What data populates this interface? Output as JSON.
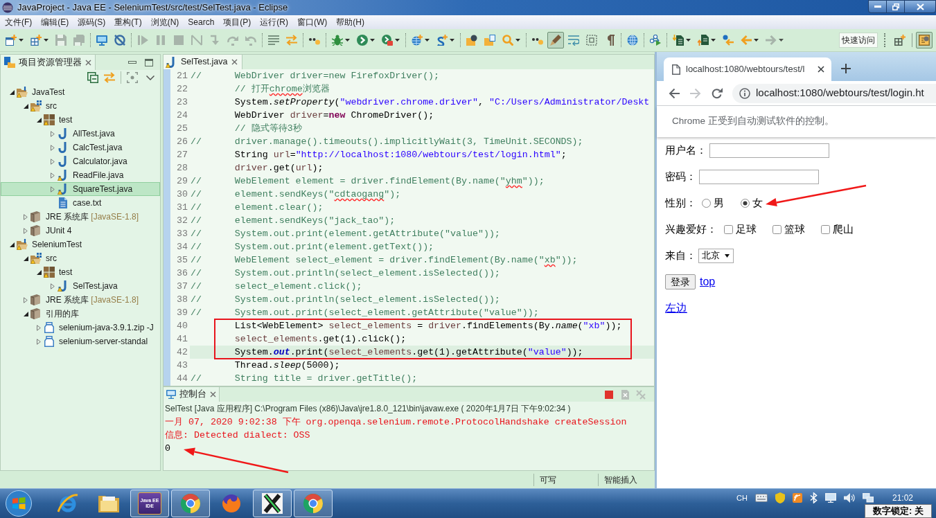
{
  "window": {
    "title": "JavaProject - Java EE - SeleniumTest/src/test/SelTest.java - Eclipse"
  },
  "menu": [
    "文件(F)",
    "编辑(E)",
    "源码(S)",
    "重构(T)",
    "浏览(N)",
    "Search",
    "项目(P)",
    "运行(R)",
    "窗口(W)",
    "帮助(H)"
  ],
  "toolbar": {
    "groups": [
      {
        "items": [
          {
            "dropdown": true,
            "disabled": false,
            "pressed": false
          },
          {
            "dropdown": true,
            "disabled": false,
            "pressed": false
          },
          {
            "dropdown": false,
            "disabled": true,
            "pressed": false
          },
          {
            "dropdown": false,
            "disabled": true,
            "pressed": false
          }
        ]
      },
      {
        "items": [
          {
            "dropdown": false,
            "disabled": false,
            "pressed": false
          },
          {
            "dropdown": false,
            "disabled": false,
            "pressed": false
          }
        ]
      },
      {
        "items": [
          {
            "dropdown": false,
            "disabled": true,
            "pressed": false
          },
          {
            "dropdown": false,
            "disabled": true,
            "pressed": false
          },
          {
            "dropdown": false,
            "disabled": true,
            "pressed": false
          },
          {
            "dropdown": false,
            "disabled": true,
            "pressed": false
          },
          {
            "dropdown": false,
            "disabled": true,
            "pressed": false
          },
          {
            "dropdown": false,
            "disabled": true,
            "pressed": false
          },
          {
            "dropdown": false,
            "disabled": true,
            "pressed": false
          }
        ]
      },
      {
        "items": [
          {
            "dropdown": false,
            "disabled": false,
            "pressed": false
          },
          {
            "dropdown": false,
            "disabled": false,
            "pressed": false
          }
        ]
      },
      {
        "items": [
          {
            "dropdown": false,
            "disabled": false,
            "pressed": false
          }
        ]
      },
      {
        "items": [
          {
            "dropdown": true,
            "disabled": false,
            "pressed": false
          },
          {
            "dropdown": true,
            "disabled": false,
            "pressed": false
          },
          {
            "dropdown": true,
            "disabled": false,
            "pressed": false
          }
        ]
      },
      {
        "items": [
          {
            "dropdown": true,
            "disabled": false,
            "pressed": false
          },
          {
            "dropdown": true,
            "disabled": false,
            "pressed": false
          }
        ]
      },
      {
        "items": [
          {
            "dropdown": false,
            "disabled": false,
            "pressed": false
          },
          {
            "dropdown": false,
            "disabled": false,
            "pressed": false
          },
          {
            "dropdown": true,
            "disabled": false,
            "pressed": false
          }
        ]
      },
      {
        "items": [
          {
            "dropdown": false,
            "disabled": false,
            "pressed": false
          },
          {
            "dropdown": false,
            "disabled": false,
            "pressed": true
          },
          {
            "dropdown": false,
            "disabled": false,
            "pressed": false
          },
          {
            "dropdown": false,
            "disabled": false,
            "pressed": false
          },
          {
            "dropdown": false,
            "disabled": false,
            "pressed": false
          }
        ]
      },
      {
        "items": [
          {
            "dropdown": false,
            "disabled": false,
            "pressed": false
          }
        ]
      },
      {
        "items": [
          {
            "dropdown": false,
            "disabled": false,
            "pressed": false
          }
        ]
      },
      {
        "items": [
          {
            "dropdown": true,
            "disabled": false,
            "pressed": false
          },
          {
            "dropdown": true,
            "disabled": false,
            "pressed": false
          },
          {
            "dropdown": false,
            "disabled": false,
            "pressed": false
          },
          {
            "dropdown": true,
            "disabled": false,
            "pressed": false
          },
          {
            "dropdown": true,
            "disabled": true,
            "pressed": false
          }
        ]
      }
    ],
    "quick_access": {
      "placeholder": "快速访问"
    },
    "perspectives": [
      {
        "selected": false
      },
      {
        "selected": true
      }
    ]
  },
  "explorer": {
    "title": "项目资源管理器",
    "tree": [
      {
        "label": "JavaTest",
        "kind": "project",
        "expanded": true,
        "warning": true,
        "selected": false,
        "children": [
          {
            "label": "src",
            "kind": "source_folder",
            "expanded": true,
            "warning": true,
            "selected": false,
            "children": [
              {
                "label": "test",
                "kind": "package",
                "expanded": true,
                "warning": true,
                "selected": false,
                "children": [
                  {
                    "label": "AllTest.java",
                    "kind": "java_file",
                    "expanded": false,
                    "warning": false,
                    "selected": false
                  },
                  {
                    "label": "CalcTest.java",
                    "kind": "java_file",
                    "expanded": false,
                    "warning": false,
                    "selected": false
                  },
                  {
                    "label": "Calculator.java",
                    "kind": "java_file",
                    "expanded": false,
                    "warning": false,
                    "selected": false
                  },
                  {
                    "label": "ReadFile.java",
                    "kind": "java_file",
                    "expanded": false,
                    "warning": true,
                    "selected": false
                  },
                  {
                    "label": "SquareTest.java",
                    "kind": "java_file",
                    "expanded": false,
                    "warning": true,
                    "selected": true
                  },
                  {
                    "label": "case.txt",
                    "kind": "text_file",
                    "warning": false,
                    "selected": false
                  }
                ]
              }
            ]
          },
          {
            "label": "JRE 系统库",
            "decoration": "[JavaSE-1.8]",
            "kind": "library",
            "expanded": false,
            "warning": false,
            "selected": false
          },
          {
            "label": "JUnit 4",
            "kind": "library",
            "expanded": false,
            "warning": false,
            "selected": false
          }
        ]
      },
      {
        "label": "SeleniumTest",
        "kind": "project",
        "expanded": true,
        "warning": true,
        "selected": false,
        "children": [
          {
            "label": "src",
            "kind": "source_folder",
            "expanded": true,
            "warning": true,
            "selected": false,
            "children": [
              {
                "label": "test",
                "kind": "package",
                "expanded": true,
                "warning": true,
                "selected": false,
                "children": [
                  {
                    "label": "SelTest.java",
                    "kind": "java_file",
                    "expanded": false,
                    "warning": true,
                    "selected": false
                  }
                ]
              }
            ]
          },
          {
            "label": "JRE 系统库",
            "decoration": "[JavaSE-1.8]",
            "kind": "library",
            "expanded": false,
            "warning": false,
            "selected": false
          },
          {
            "label": "引用的库",
            "kind": "library",
            "expanded": true,
            "warning": false,
            "selected": false,
            "children": [
              {
                "label": "selenium-java-3.9.1.zip -J",
                "kind": "archive",
                "expanded": false,
                "warning": false,
                "selected": false
              },
              {
                "label": "selenium-server-standal",
                "kind": "archive",
                "expanded": false,
                "warning": false,
                "selected": false
              }
            ]
          }
        ]
      }
    ]
  },
  "editor": {
    "tabs": [
      {
        "label": "SelTest.java",
        "selected": true,
        "warning": true
      }
    ],
    "lines": [
      {
        "number": "21",
        "prefix": "//",
        "tokens": [
          {
            "text": "WebDriver driver=new FirefoxDriver();",
            "kind": "comment"
          }
        ],
        "current": false,
        "boxed": false
      },
      {
        "number": "22",
        "tokens": [
          {
            "text": "// 打开",
            "kind": "comment"
          },
          {
            "text": "chrome",
            "kind": "comment_typo"
          },
          {
            "text": "浏览器",
            "kind": "comment"
          }
        ],
        "current": false,
        "boxed": false
      },
      {
        "number": "23",
        "tokens": [
          {
            "text": "System.",
            "kind": "plain"
          },
          {
            "text": "setProperty",
            "kind": "static"
          },
          {
            "text": "(",
            "kind": "plain"
          },
          {
            "text": "\"webdriver.chrome.driver\"",
            "kind": "string"
          },
          {
            "text": ", ",
            "kind": "plain"
          },
          {
            "text": "\"C:/Users/Administrator/Deskt",
            "kind": "string"
          }
        ],
        "current": false,
        "boxed": false
      },
      {
        "number": "24",
        "tokens": [
          {
            "text": "WebDriver ",
            "kind": "plain"
          },
          {
            "text": "driver",
            "kind": "local"
          },
          {
            "text": "=",
            "kind": "plain"
          },
          {
            "text": "new",
            "kind": "keyword"
          },
          {
            "text": " ChromeDriver();",
            "kind": "plain"
          }
        ],
        "current": false,
        "boxed": false
      },
      {
        "number": "25",
        "tokens": [
          {
            "text": "// 隐式等待3秒",
            "kind": "comment"
          }
        ],
        "current": false,
        "boxed": false
      },
      {
        "number": "26",
        "prefix": "//",
        "tokens": [
          {
            "text": "driver.manage().timeouts().implicitlyWait(3, TimeUnit.SECONDS);",
            "kind": "comment"
          }
        ],
        "current": false,
        "boxed": false
      },
      {
        "number": "27",
        "tokens": [
          {
            "text": "String ",
            "kind": "plain"
          },
          {
            "text": "url",
            "kind": "local"
          },
          {
            "text": "=",
            "kind": "plain"
          },
          {
            "text": "\"http://localhost:1080/webtours/test/login.html\"",
            "kind": "string"
          },
          {
            "text": ";",
            "kind": "plain"
          }
        ],
        "current": false,
        "boxed": false
      },
      {
        "number": "28",
        "tokens": [
          {
            "text": "driver",
            "kind": "local"
          },
          {
            "text": ".get(",
            "kind": "plain"
          },
          {
            "text": "url",
            "kind": "local"
          },
          {
            "text": ");",
            "kind": "plain"
          }
        ],
        "current": false,
        "boxed": false
      },
      {
        "number": "29",
        "prefix": "//",
        "tokens": [
          {
            "text": "WebElement element = driver.findElement(By.name(\"",
            "kind": "comment"
          },
          {
            "text": "yhm",
            "kind": "comment_typo"
          },
          {
            "text": "\"));",
            "kind": "comment"
          }
        ],
        "current": false,
        "boxed": false
      },
      {
        "number": "30",
        "prefix": "//",
        "tokens": [
          {
            "text": "element.sendKeys(\"",
            "kind": "comment"
          },
          {
            "text": "cdtaogang",
            "kind": "comment_typo"
          },
          {
            "text": "\");",
            "kind": "comment"
          }
        ],
        "current": false,
        "boxed": false
      },
      {
        "number": "31",
        "prefix": "//",
        "tokens": [
          {
            "text": "element.clear();",
            "kind": "comment"
          }
        ],
        "current": false,
        "boxed": false
      },
      {
        "number": "32",
        "prefix": "//",
        "tokens": [
          {
            "text": "element.sendKeys(\"jack_tao\");",
            "kind": "comment"
          }
        ],
        "current": false,
        "boxed": false
      },
      {
        "number": "33",
        "prefix": "//",
        "tokens": [
          {
            "text": "System.out.print(element.getAttribute(\"value\"));",
            "kind": "comment"
          }
        ],
        "current": false,
        "boxed": false
      },
      {
        "number": "34",
        "prefix": "//",
        "tokens": [
          {
            "text": "System.out.print(element.getText());",
            "kind": "comment"
          }
        ],
        "current": false,
        "boxed": false
      },
      {
        "number": "35",
        "prefix": "//",
        "tokens": [
          {
            "text": "WebElement select_element = driver.findElement(By.name(\"",
            "kind": "comment"
          },
          {
            "text": "xb",
            "kind": "comment_typo"
          },
          {
            "text": "\"));",
            "kind": "comment"
          }
        ],
        "current": false,
        "boxed": false
      },
      {
        "number": "36",
        "prefix": "//",
        "tokens": [
          {
            "text": "System.out.println(select_element.isSelected());",
            "kind": "comment"
          }
        ],
        "current": false,
        "boxed": false
      },
      {
        "number": "37",
        "prefix": "//",
        "tokens": [
          {
            "text": "select_element.click();",
            "kind": "comment"
          }
        ],
        "current": false,
        "boxed": false
      },
      {
        "number": "38",
        "prefix": "//",
        "tokens": [
          {
            "text": "System.out.println(select_element.isSelected());",
            "kind": "comment"
          }
        ],
        "current": false,
        "boxed": false
      },
      {
        "number": "39",
        "prefix": "//",
        "tokens": [
          {
            "text": "System.out.print(select_element.getAttribute(\"value\"));",
            "kind": "comment"
          }
        ],
        "current": false,
        "boxed": false
      },
      {
        "number": "40",
        "tokens": [
          {
            "text": "List<WebElement> ",
            "kind": "plain"
          },
          {
            "text": "select_elements",
            "kind": "local"
          },
          {
            "text": " = ",
            "kind": "plain"
          },
          {
            "text": "driver",
            "kind": "local"
          },
          {
            "text": ".findElements(By.",
            "kind": "plain"
          },
          {
            "text": "name",
            "kind": "static"
          },
          {
            "text": "(",
            "kind": "plain"
          },
          {
            "text": "\"xb\"",
            "kind": "string"
          },
          {
            "text": "));",
            "kind": "plain"
          }
        ],
        "current": false,
        "boxed": true
      },
      {
        "number": "41",
        "tokens": [
          {
            "text": "select_elements",
            "kind": "local"
          },
          {
            "text": ".get(1).click();",
            "kind": "plain"
          }
        ],
        "current": false,
        "boxed": true
      },
      {
        "number": "42",
        "tokens": [
          {
            "text": "System.",
            "kind": "plain"
          },
          {
            "text": "out",
            "kind": "field"
          },
          {
            "text": ".print(",
            "kind": "plain"
          },
          {
            "text": "select_elements",
            "kind": "local"
          },
          {
            "text": ".get(1).getAttribute(",
            "kind": "plain"
          },
          {
            "text": "\"value\"",
            "kind": "string"
          },
          {
            "text": "));",
            "kind": "plain"
          }
        ],
        "current": true,
        "boxed": true
      },
      {
        "number": "43",
        "tokens": [
          {
            "text": "Thread.",
            "kind": "plain"
          },
          {
            "text": "sleep",
            "kind": "static"
          },
          {
            "text": "(5000);",
            "kind": "plain"
          }
        ],
        "current": false,
        "boxed": false
      },
      {
        "number": "44",
        "prefix": "//",
        "tokens": [
          {
            "text": "String title = driver.getTitle();",
            "kind": "comment"
          }
        ],
        "current": false,
        "boxed": false
      }
    ]
  },
  "console": {
    "title": "控制台",
    "toolbar": [
      {
        "disabled": false
      },
      {
        "disabled": true
      },
      {
        "disabled": true
      }
    ],
    "description": "SelTest [Java 应用程序] C:\\Program Files (x86)\\Java\\jre1.8.0_121\\bin\\javaw.exe ( 2020年1月7日 下午9:02:34 )",
    "lines": [
      {
        "text": "一月 07, 2020 9:02:38 下午 org.openqa.selenium.remote.ProtocolHandshake createSession",
        "kind": "stderr",
        "marked": false
      },
      {
        "text": "信息: Detected dialect: OSS",
        "kind": "stderr",
        "marked": false
      },
      {
        "text": "0",
        "kind": "stdout",
        "marked": true
      }
    ]
  },
  "status_bar": {
    "items": [
      "可写",
      "智能插入"
    ]
  },
  "browser": {
    "tabs": [
      {
        "title": "localhost:1080/webtours/test/l",
        "selected": true
      }
    ],
    "nav": [
      {
        "disabled": false
      },
      {
        "disabled": true
      },
      {
        "disabled": false
      }
    ],
    "address": "localhost:1080/webtours/test/login.ht",
    "infobar": "Chrome 正受到自动测试软件的控制。",
    "form": {
      "rows": [
        {
          "kind": "text",
          "label": "用户名："
        },
        {
          "kind": "text",
          "label": "密码："
        },
        {
          "kind": "radio",
          "label": "性别：",
          "options": [
            {
              "label": "男",
              "selected": false,
              "marked": false
            },
            {
              "label": "女",
              "selected": true,
              "marked": true
            }
          ]
        },
        {
          "kind": "checkbox",
          "label": "兴趣爱好：",
          "options": [
            {
              "label": "足球",
              "checked": false
            },
            {
              "label": "篮球",
              "checked": false
            },
            {
              "label": "爬山",
              "checked": false
            }
          ]
        },
        {
          "kind": "select",
          "label": "来自：",
          "value": "北京"
        },
        {
          "kind": "actions",
          "button": "登录",
          "link": "top"
        },
        {
          "kind": "link",
          "link": "左边"
        }
      ]
    }
  },
  "taskbar": {
    "apps": [
      {
        "running": false
      },
      {
        "running": false
      },
      {
        "running": true,
        "icon_text": "Java EE IDE"
      },
      {
        "running": true
      },
      {
        "running": false
      },
      {
        "running": true
      },
      {
        "running": true
      }
    ],
    "tray": {
      "language": "CH",
      "time": "21:02"
    },
    "numlock": "数字锁定: 关"
  }
}
